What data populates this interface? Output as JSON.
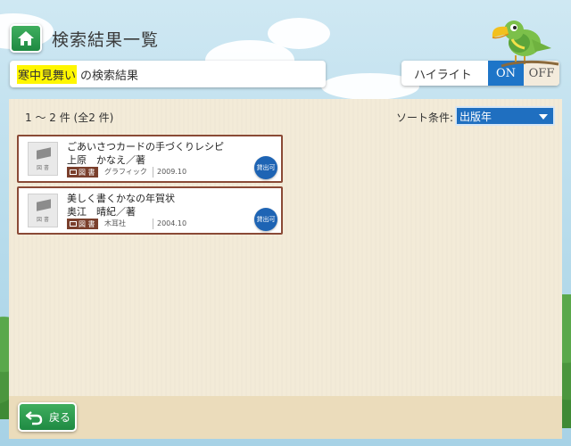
{
  "header": {
    "title": "検索結果一覧",
    "search_term": "寒中見舞い",
    "search_suffix": "の検索結果"
  },
  "highlight": {
    "label": "ハイライト",
    "on_label": "ON",
    "off_label": "OFF",
    "state": "ON"
  },
  "results_info": {
    "count_text": "1 〜 2 件 (全2 件)",
    "sort_label": "ソート条件:",
    "sort_value": "出版年"
  },
  "results": [
    {
      "title": "ごあいさつカードの手づくりレシピ",
      "author": "上原　かなえ／著",
      "type": "図 書",
      "publisher": "グラフィック",
      "year": "2009.10",
      "status": "貸出可",
      "thumb_caption": "図 書"
    },
    {
      "title": "美しく書くかなの年賀状",
      "author": "奥江　晴紀／著",
      "type": "図 書",
      "publisher": "木耳社",
      "year": "2004.10",
      "status": "貸出可",
      "thumb_caption": "図 書"
    }
  ],
  "footer": {
    "back_label": "戻る"
  },
  "colors": {
    "accent_green": "#2a9a4f",
    "accent_blue": "#1e75c8",
    "border_brown": "#8a4a36",
    "highlight_yellow": "#fff600"
  },
  "icons": [
    "home-icon",
    "back-arrow-icon",
    "book-icon",
    "toucan-mascot"
  ]
}
